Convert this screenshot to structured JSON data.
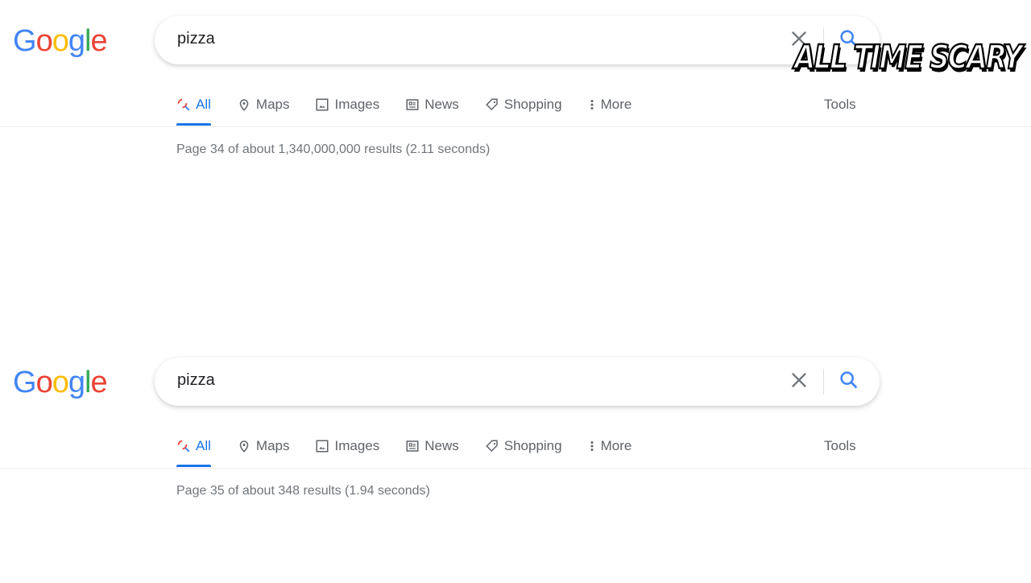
{
  "panels": [
    {
      "query": "pizza",
      "tabs": [
        "All",
        "Maps",
        "Images",
        "News",
        "Shopping",
        "More"
      ],
      "tools": "Tools",
      "stats": "Page 34 of about 1,340,000,000 results (2.11 seconds)"
    },
    {
      "query": "pizza",
      "tabs": [
        "All",
        "Maps",
        "Images",
        "News",
        "Shopping",
        "More"
      ],
      "tools": "Tools",
      "stats": "Page 35 of about 348 results (1.94 seconds)"
    }
  ],
  "logo": "Google",
  "watermark": "ALL TIME SCARY",
  "colors": {
    "accent": "#1a73e8",
    "text": "#5f6368"
  }
}
